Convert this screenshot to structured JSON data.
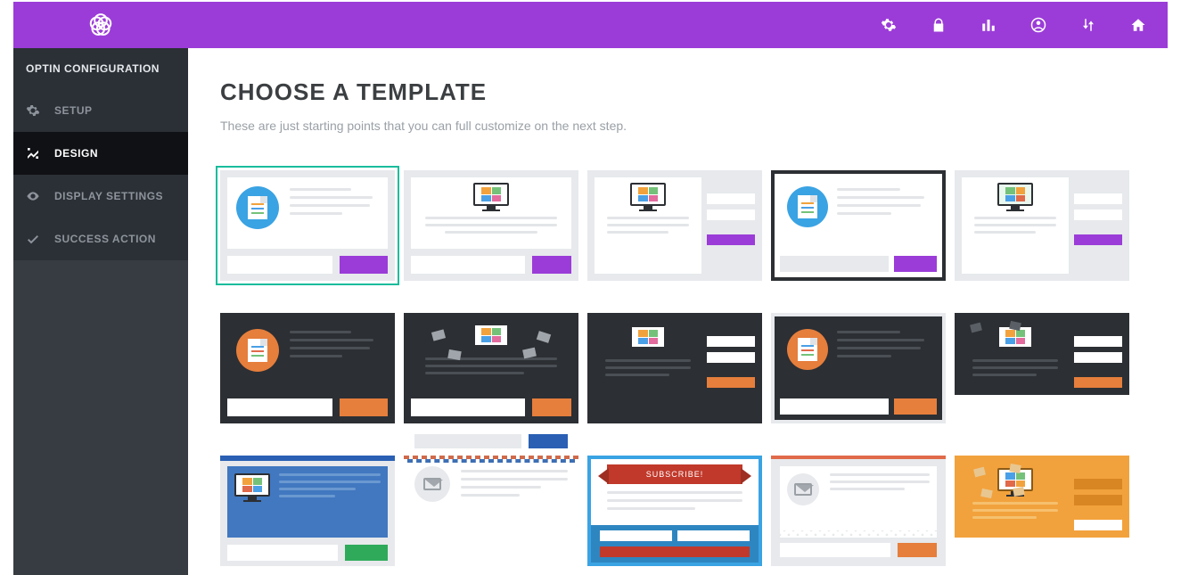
{
  "colors": {
    "accent": "#9b3cd8",
    "orange": "#e67e3c",
    "teal": "#1abc9c",
    "dark": "#2c2f33"
  },
  "topbar": {
    "logo_name": "bloom-logo",
    "icons": [
      {
        "name": "settings-icon"
      },
      {
        "name": "lock-icon"
      },
      {
        "name": "analytics-icon"
      },
      {
        "name": "account-icon"
      },
      {
        "name": "import-export-icon"
      },
      {
        "name": "home-icon"
      }
    ]
  },
  "sidebar": {
    "section_title": "OPTIN CONFIGURATION",
    "items": [
      {
        "icon": "gear-icon",
        "label": "SETUP",
        "active": false
      },
      {
        "icon": "design-icon",
        "label": "DESIGN",
        "active": true
      },
      {
        "icon": "eye-icon",
        "label": "DISPLAY SETTINGS",
        "active": false
      },
      {
        "icon": "check-icon",
        "label": "SUCCESS ACTION",
        "active": false
      }
    ]
  },
  "main": {
    "title": "CHOOSE A TEMPLATE",
    "subtitle": "These are just starting points that you can full customize on the next step.",
    "templates": [
      {
        "id": "row1-light-circle-doc",
        "selected": true,
        "ribbon_text": ""
      },
      {
        "id": "row1-light-monitor",
        "selected": false,
        "ribbon_text": ""
      },
      {
        "id": "row1-light-monitor-split",
        "selected": false,
        "ribbon_text": ""
      },
      {
        "id": "row1-bordered-circle-doc",
        "selected": false,
        "ribbon_text": ""
      },
      {
        "id": "row1-light-green-monitor",
        "selected": false,
        "ribbon_text": ""
      },
      {
        "id": "row2-dark-circle-doc",
        "selected": false,
        "ribbon_text": ""
      },
      {
        "id": "row2-dark-monitor-mail",
        "selected": false,
        "ribbon_text": ""
      },
      {
        "id": "row2-dark-monitor-split",
        "selected": false,
        "ribbon_text": ""
      },
      {
        "id": "row2-dark-bordered-circle",
        "selected": false,
        "ribbon_text": ""
      },
      {
        "id": "row2-dark-split-mail",
        "selected": false,
        "ribbon_text": ""
      },
      {
        "id": "row3-blue-monitor",
        "selected": false,
        "ribbon_text": ""
      },
      {
        "id": "row3-airmail-envelope",
        "selected": false,
        "ribbon_text": ""
      },
      {
        "id": "row3-ribbon-subscribe",
        "selected": false,
        "ribbon_text": "SUBSCRIBE!"
      },
      {
        "id": "row3-zigzag-envelope",
        "selected": false,
        "ribbon_text": ""
      },
      {
        "id": "row3-orange-split",
        "selected": false,
        "ribbon_text": ""
      }
    ]
  }
}
